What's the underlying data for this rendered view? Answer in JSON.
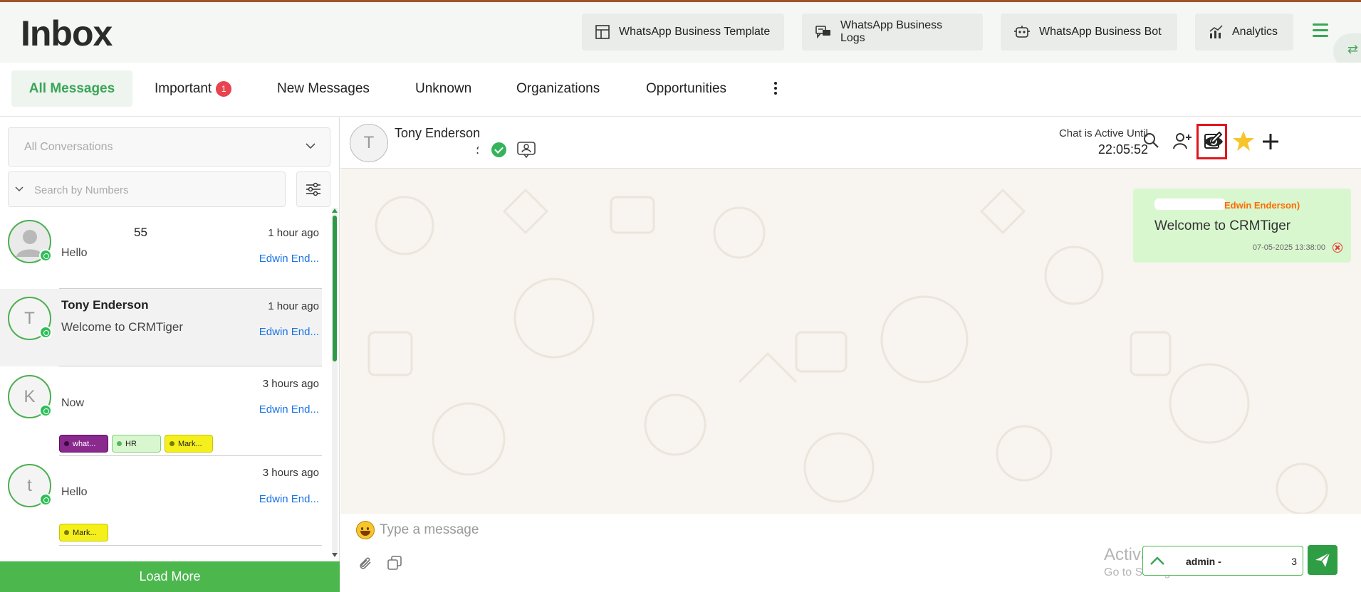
{
  "page_title": "Inbox",
  "header_buttons": [
    {
      "label": "WhatsApp Business Template",
      "icon": "template-icon"
    },
    {
      "label": "WhatsApp Business Logs",
      "icon": "chat-log-icon"
    },
    {
      "label": "WhatsApp Business Bot",
      "icon": "bot-icon"
    },
    {
      "label": "Analytics",
      "icon": "analytics-icon"
    }
  ],
  "tabs": [
    {
      "label": "All Messages",
      "active": true
    },
    {
      "label": "Important",
      "badge": "1"
    },
    {
      "label": "New Messages"
    },
    {
      "label": "Unknown"
    },
    {
      "label": "Organizations"
    },
    {
      "label": "Opportunities"
    }
  ],
  "filters": {
    "conversation_select": "All Conversations",
    "search_placeholder": "Search by Numbers"
  },
  "contacts": [
    {
      "name": "55",
      "time": "1 hour ago",
      "message": "Hello",
      "agent": "Edwin End...",
      "avatar": "user-silhouette-icon",
      "tags": []
    },
    {
      "name": "Tony Enderson",
      "time": "1 hour ago",
      "message": "Welcome to CRMTiger",
      "agent": "Edwin End...",
      "avatar_letter": "T",
      "selected": true,
      "tags": []
    },
    {
      "name": "",
      "time": "3 hours ago",
      "message": "Now",
      "agent": "Edwin End...",
      "avatar_letter": "K",
      "tags": [
        {
          "label": "what...",
          "bg": "#8a2a8f",
          "dot": "#3a0a3a",
          "color": "#ffffff"
        },
        {
          "label": "HR",
          "bg": "#d9f7cf",
          "dot": "#56b65a",
          "color": "#222222"
        },
        {
          "label": "Mark...",
          "bg": "#f5f01b",
          "dot": "#7a7a00",
          "color": "#222222"
        }
      ]
    },
    {
      "name": "",
      "time": "3 hours ago",
      "message": "Hello",
      "agent": "Edwin End...",
      "avatar_letter": "t",
      "tags": [
        {
          "label": "Mark...",
          "bg": "#f5f01b",
          "dot": "#7a7a00",
          "color": "#222222"
        }
      ]
    }
  ],
  "load_more": "Load More",
  "chat": {
    "avatar_letter": "T",
    "contact_name": "Tony Enderson",
    "status_suffix": "؛",
    "active_label": "Chat is Active Until",
    "active_time": "22:05:52",
    "header_icons": [
      "search-icon",
      "add-user-icon",
      "eye-icon",
      "edit-icon",
      "star-icon",
      "plus-icon"
    ],
    "messages": [
      {
        "sender": "Edwin Enderson)",
        "text": "Welcome to CRMTiger",
        "timestamp": "07-05-2025 13:38:00",
        "status": "failed"
      }
    ]
  },
  "composer": {
    "placeholder": "Type a message",
    "agent_label": "admin -",
    "agent_suffix": "3"
  },
  "watermark": {
    "line1": "Activate Windows",
    "line2": "Go to Settings to activate Windows."
  },
  "colors": {
    "brand_green": "#4bb74d",
    "tab_active": "#3aa657",
    "agent_link": "#1a73e8",
    "badge_red": "#e8434f",
    "bubble": "#d9f7cf",
    "highlight": "#e0161d"
  }
}
